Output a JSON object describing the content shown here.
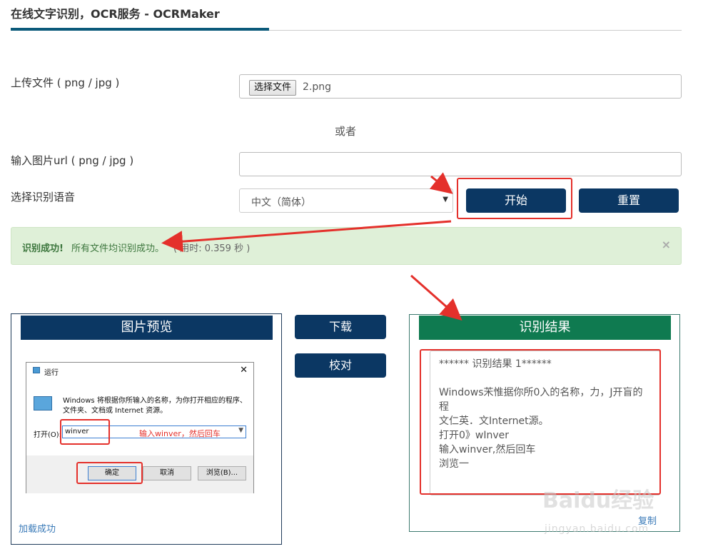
{
  "page": {
    "title": "在线文字识别，OCR服务 - OCRMaker"
  },
  "form": {
    "upload_label": "上传文件 ( png / jpg )",
    "choose_file_button": "选择文件",
    "file_name": "2.png",
    "or_text": "或者",
    "url_label": "输入图片url ( png / jpg )",
    "url_value": "",
    "language_label": "选择识别语音",
    "language_selected": "中文（简体）",
    "start_button": "开始",
    "reset_button": "重置"
  },
  "alert": {
    "strong": "识别成功!",
    "message": "所有文件均识别成功。",
    "time": "( 用时: 0.359 秒 )",
    "close": "×"
  },
  "preview": {
    "title": "图片预览",
    "loaded": "加载成功",
    "run_dialog": {
      "title": "运行",
      "close": "✕",
      "desc_line1": "Windows 将根据你所输入的名称，为你打开相应的程序、",
      "desc_line2": "文件夹、文档或 Internet 资源。",
      "open_label": "打开(O):",
      "input_value": "winver",
      "hint": "输入winver，然后回车",
      "ok_button": "确定",
      "cancel_button": "取消",
      "browse_button": "浏览(B)..."
    }
  },
  "actions": {
    "download_button": "下载",
    "proofread_button": "校对"
  },
  "result": {
    "title": "识别结果",
    "lines": [
      "****** 识别结果 1******",
      "",
      "Windows㭉惟据你所0入的名称，力，J开盲的",
      "程",
      "文仁英．文Internet源。",
      "打开0》wInver",
      "输入winver,然后回车",
      "浏览一"
    ],
    "copy_link": "复制"
  },
  "watermark": {
    "main": "Baidu经验",
    "sub": "jingyan.baidu.com"
  },
  "colors": {
    "primary_button": "#0b3763",
    "result_header": "#0f7a50",
    "annotation_red": "#e4302b",
    "success_bg": "#dff0d8"
  }
}
